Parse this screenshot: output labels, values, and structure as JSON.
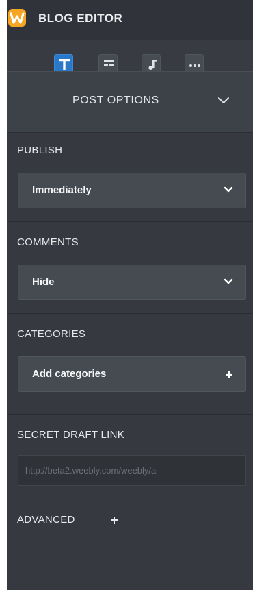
{
  "app": {
    "title": "BLOG EDITOR",
    "logo_icon": "weebly-w-logo",
    "brand_color": "#f6a623"
  },
  "toolbar": {
    "tools": [
      {
        "icon": "text-icon",
        "active": true
      },
      {
        "icon": "layout-icon",
        "active": false
      },
      {
        "icon": "music-icon",
        "active": false
      },
      {
        "icon": "more-icon",
        "active": false
      }
    ],
    "active_color": "#2a79c9"
  },
  "post_options": {
    "title": "POST OPTIONS",
    "toggle_icon": "chevron-down-icon"
  },
  "publish": {
    "label": "PUBLISH",
    "value": "Immediately",
    "icon": "chevron-down-icon"
  },
  "comments": {
    "label": "COMMENTS",
    "value": "Hide",
    "icon": "chevron-down-icon"
  },
  "categories": {
    "label": "CATEGORIES",
    "value": "Add categories",
    "icon": "plus-icon"
  },
  "secret_link": {
    "label": "SECRET DRAFT LINK",
    "value": "http://beta2.weebly.com/weebly/a"
  },
  "advanced": {
    "label": "ADVANCED",
    "icon": "plus-icon"
  }
}
